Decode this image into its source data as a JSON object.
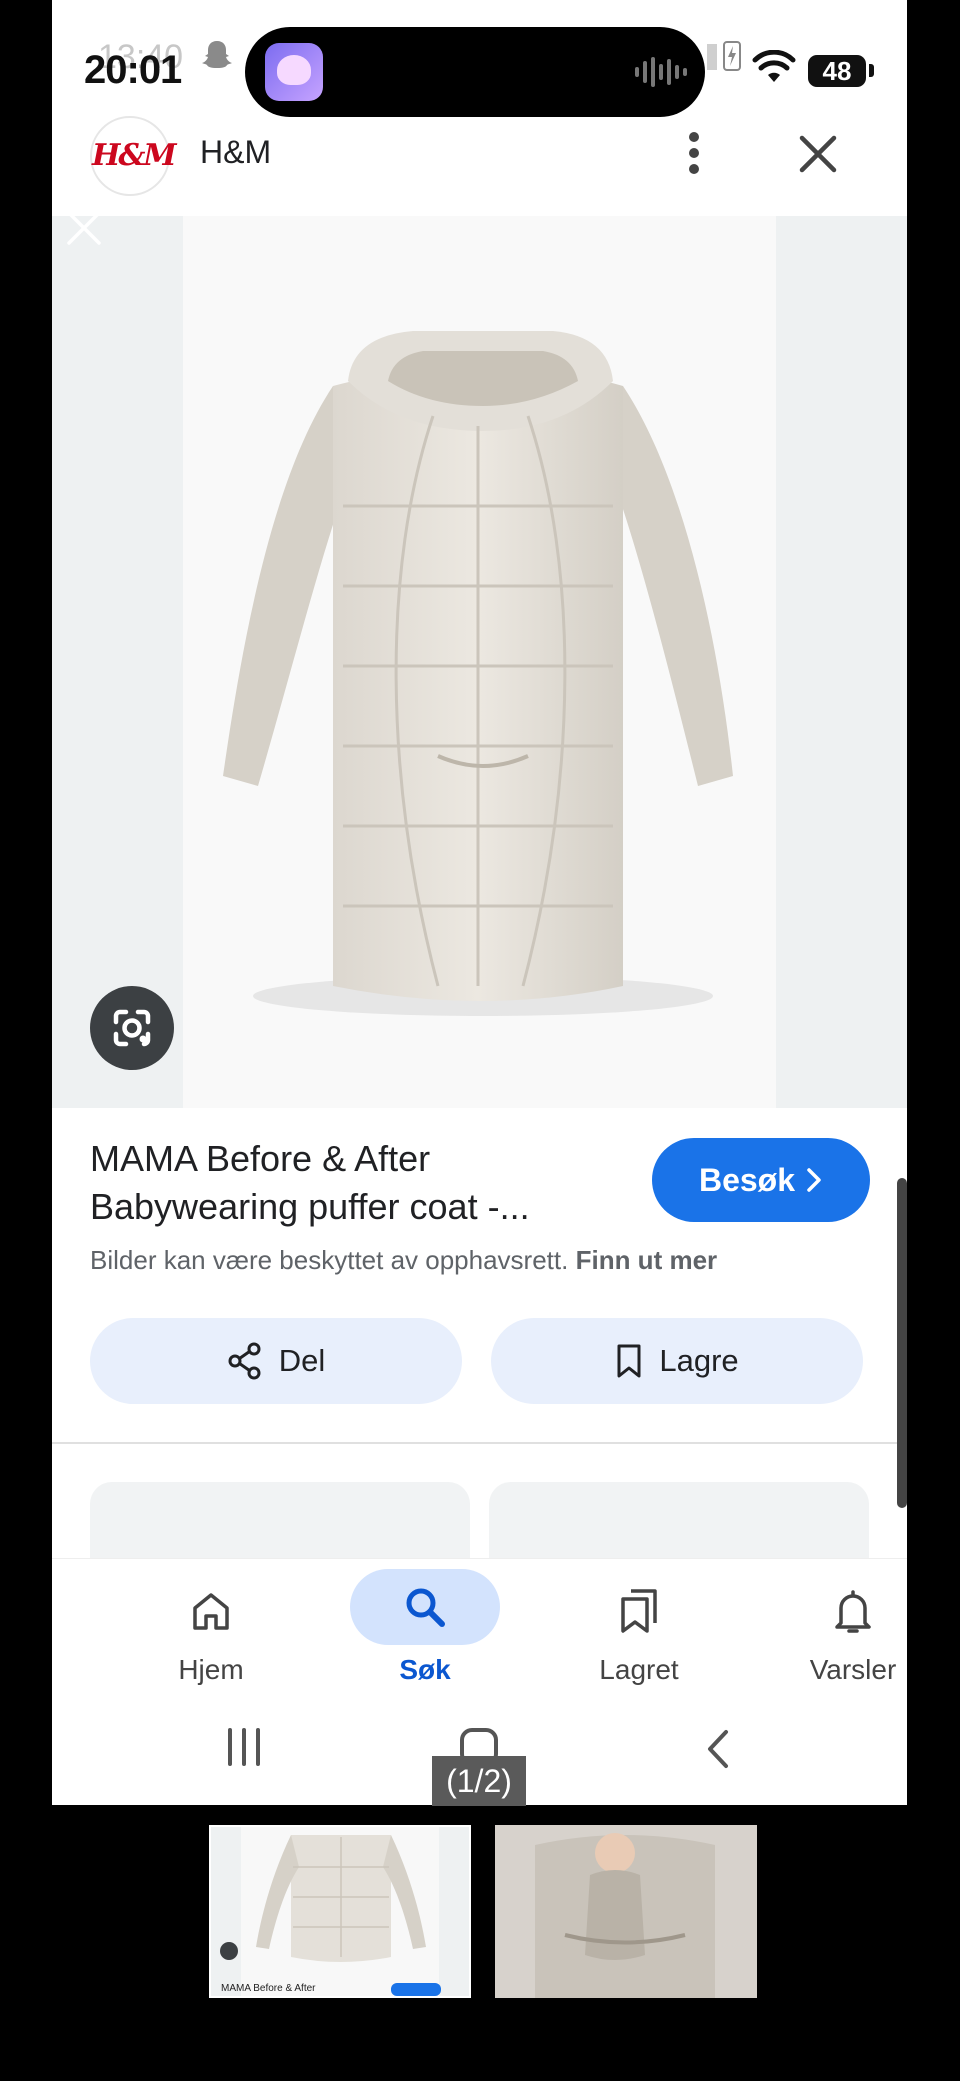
{
  "status_bar": {
    "time": "20:01",
    "ghost_time": "13:40",
    "battery": "48",
    "icons": [
      "snapchat-icon",
      "wifi-icon",
      "battery-icon",
      "charging-icon"
    ]
  },
  "header": {
    "logo_text": "H&M",
    "site_name": "H&M",
    "icons": [
      "more-vert-icon",
      "close-icon"
    ]
  },
  "product": {
    "title": "MAMA Before & After Babywearing puffer coat -...",
    "visit_label": "Besøk",
    "copyright_text": "Bilder kan være beskyttet av opphavsrett.",
    "copyright_link": "Finn ut mer",
    "share_label": "Del",
    "save_label": "Lagre"
  },
  "bottom_nav": {
    "items": [
      {
        "label": "Hjem",
        "icon": "home-icon",
        "active": false
      },
      {
        "label": "Søk",
        "icon": "search-icon",
        "active": true
      },
      {
        "label": "Lagret",
        "icon": "bookmarks-icon",
        "active": false
      },
      {
        "label": "Varsler",
        "icon": "bell-icon",
        "active": false
      }
    ]
  },
  "page_counter": "(1/2)",
  "thumbnails": {
    "first_caption": "MAMA Before & After"
  },
  "colors": {
    "accent": "#1a73e8",
    "pill_bg": "#e8effc",
    "active_nav": "#0b57d0"
  }
}
